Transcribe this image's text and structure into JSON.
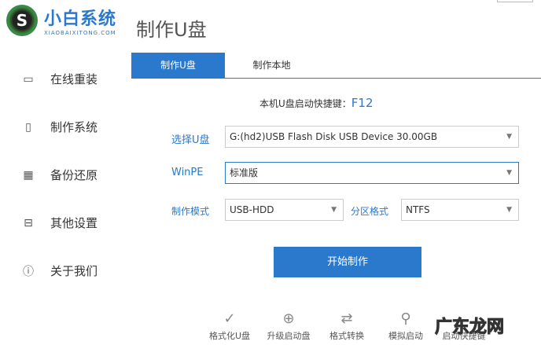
{
  "app": {
    "brand": "小白系统",
    "brand_sub": "XIAOBAIXITONG.COM",
    "title": "制作U盘"
  },
  "sidebar": {
    "items": [
      {
        "label": "在线重装",
        "icon": "monitor-icon"
      },
      {
        "label": "制作系统",
        "icon": "usb-icon"
      },
      {
        "label": "备份还原",
        "icon": "grid-icon"
      },
      {
        "label": "其他设置",
        "icon": "briefcase-icon"
      },
      {
        "label": "关于我们",
        "icon": "info-icon"
      }
    ]
  },
  "tabs": [
    {
      "label": "制作U盘",
      "active": true
    },
    {
      "label": "制作本地",
      "active": false
    }
  ],
  "form": {
    "hotkey_label": "本机U盘启动快捷键：",
    "hotkey": "F12",
    "usb_label": "选择U盘",
    "usb_value": "G:(hd2)USB Flash Disk USB Device 30.00GB",
    "winpe_label": "WinPE",
    "winpe_value": "标准版",
    "mode_label": "制作模式",
    "mode_value": "USB-HDD",
    "fs_label": "分区格式",
    "fs_value": "NTFS",
    "start_label": "开始制作"
  },
  "tools": [
    {
      "label": "格式化U盘",
      "icon": "check-circle-icon"
    },
    {
      "label": "升级启动盘",
      "icon": "arrow-up-circle-icon"
    },
    {
      "label": "格式转换",
      "icon": "convert-icon"
    },
    {
      "label": "模拟启动",
      "icon": "stamp-icon"
    },
    {
      "label": "启动快捷键",
      "icon": "key-icon"
    }
  ],
  "watermark": "广东龙网",
  "colors": {
    "accent": "#2b79cc"
  }
}
